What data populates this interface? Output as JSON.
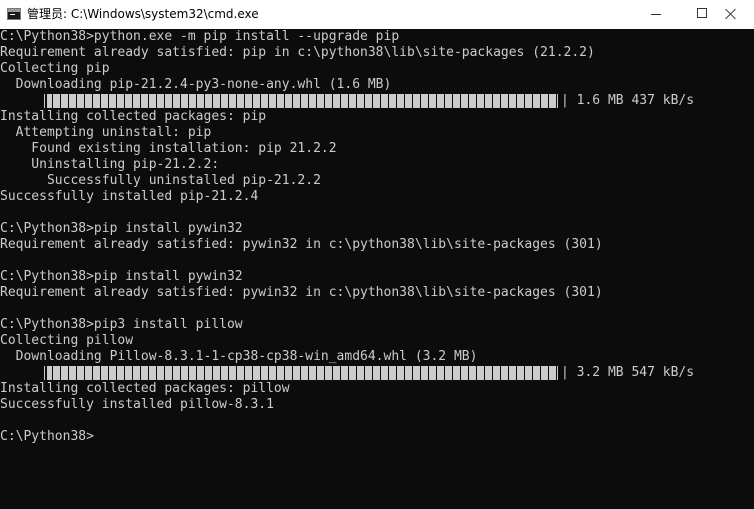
{
  "window": {
    "title": "管理员: C:\\Windows\\system32\\cmd.exe",
    "icon": "cmd-icon",
    "buttons": {
      "minimize": "minimize-icon",
      "maximize": "maximize-icon",
      "close": "close-icon"
    }
  },
  "console": {
    "text_color": "#cccccc",
    "background": "#0c0c0c",
    "lines": [
      "C:\\Python38>python.exe -m pip install --upgrade pip",
      "Requirement already satisfied: pip in c:\\python38\\lib\\site-packages (21.2.2)",
      "Collecting pip",
      "  Downloading pip-21.2.4-py3-none-any.whl (1.6 MB)",
      "",
      "Installing collected packages: pip",
      "  Attempting uninstall: pip",
      "    Found existing installation: pip 21.2.2",
      "    Uninstalling pip-21.2.2:",
      "      Successfully uninstalled pip-21.2.2",
      "Successfully installed pip-21.2.4",
      "",
      "C:\\Python38>pip install pywin32",
      "Requirement already satisfied: pywin32 in c:\\python38\\lib\\site-packages (301)",
      "",
      "C:\\Python38>pip install pywin32",
      "Requirement already satisfied: pywin32 in c:\\python38\\lib\\site-packages (301)",
      "",
      "C:\\Python38>pip3 install pillow",
      "Collecting pillow",
      "  Downloading Pillow-8.3.1-1-cp38-cp38-win_amd64.whl (3.2 MB)",
      "",
      "Installing collected packages: pillow",
      "Successfully installed pillow-8.3.1",
      "",
      "C:\\Python38>"
    ],
    "progress_1": {
      "progress": 1.0,
      "status": "| 1.6 MB 437 kB/s"
    },
    "progress_2": {
      "progress": 1.0,
      "status": "| 3.2 MB 547 kB/s"
    }
  }
}
